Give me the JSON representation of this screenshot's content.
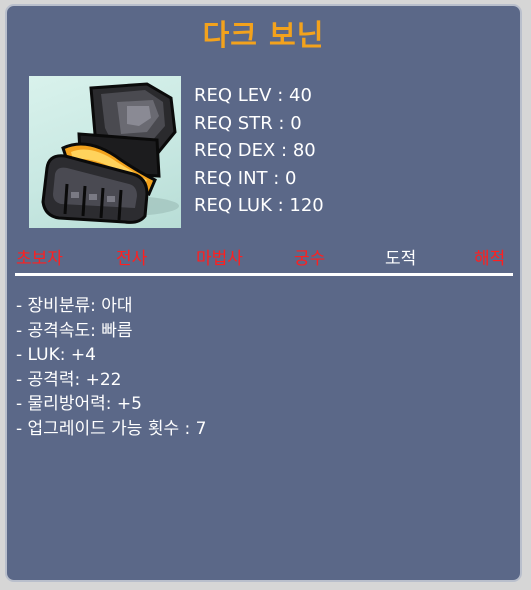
{
  "item": {
    "name": "다크 보닌",
    "icon": "dark-glove-icon"
  },
  "requirements": {
    "level": "REQ LEV : 40",
    "str": "REQ STR : 0",
    "dex": "REQ DEX : 80",
    "int": "REQ INT : 0",
    "luk": "REQ LUK : 120"
  },
  "jobs": [
    {
      "label": "초보자",
      "color": "#ff1f1f"
    },
    {
      "label": "전사",
      "color": "#ff1f1f"
    },
    {
      "label": "마법사",
      "color": "#ff1f1f"
    },
    {
      "label": "궁수",
      "color": "#ff1f1f"
    },
    {
      "label": "도적",
      "color": "#ffffff"
    },
    {
      "label": "해적",
      "color": "#ff1f1f"
    }
  ],
  "stats": [
    "- 장비분류: 아대",
    "- 공격속도: 빠름",
    "- LUK: +4",
    "- 공격력: +22",
    "- 물리방어력: +5",
    "- 업그레이드 가능 횟수 : 7"
  ],
  "colors": {
    "title": "#f3a21c",
    "background": "#5b6888",
    "unavailable_job": "#ff1f1f",
    "available_job": "#ffffff"
  }
}
